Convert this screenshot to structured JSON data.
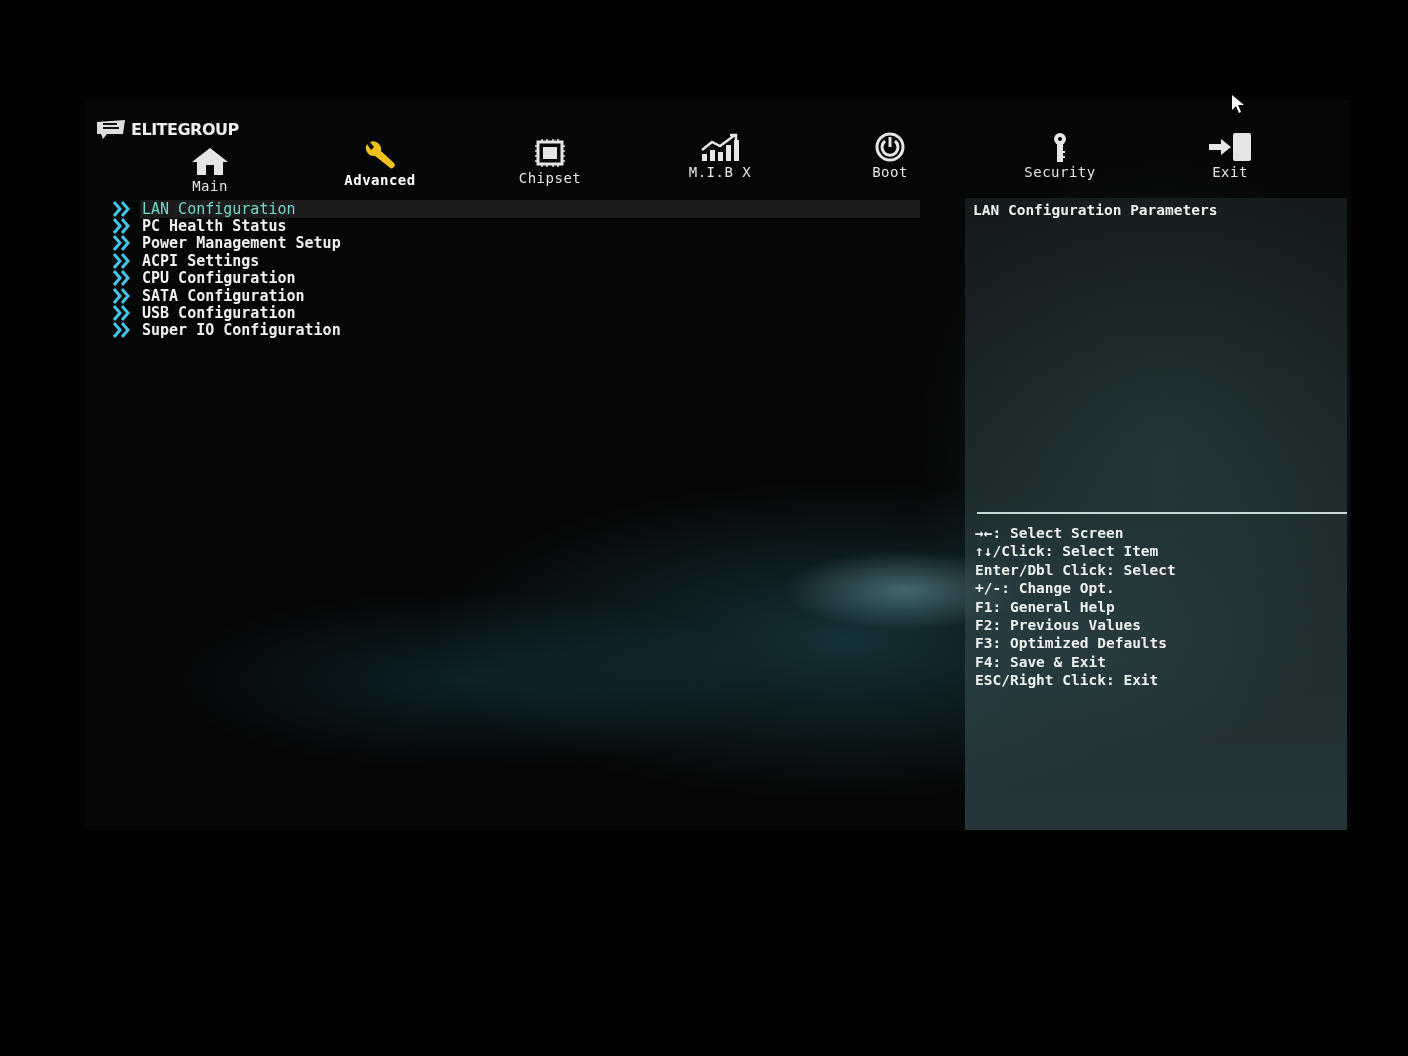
{
  "brand": "ELITEGROUP",
  "tabs": [
    {
      "label": "Main",
      "selected": false
    },
    {
      "label": "Advanced",
      "selected": true
    },
    {
      "label": "Chipset",
      "selected": false
    },
    {
      "label": "M.I.B X",
      "selected": false
    },
    {
      "label": "Boot",
      "selected": false
    },
    {
      "label": "Security",
      "selected": false
    },
    {
      "label": "Exit",
      "selected": false
    }
  ],
  "menu": [
    {
      "label": "LAN Configuration",
      "selected": true
    },
    {
      "label": "PC Health Status",
      "selected": false
    },
    {
      "label": "Power Management Setup",
      "selected": false
    },
    {
      "label": "ACPI Settings",
      "selected": false
    },
    {
      "label": "CPU Configuration",
      "selected": false
    },
    {
      "label": "SATA Configuration",
      "selected": false
    },
    {
      "label": "USB Configuration",
      "selected": false
    },
    {
      "label": "Super IO Configuration",
      "selected": false
    }
  ],
  "help": {
    "title": "LAN Configuration Parameters",
    "keys": [
      "→←: Select Screen",
      "↑↓/Click: Select Item",
      "Enter/Dbl Click: Select",
      "+/-: Change Opt.",
      "F1: General Help",
      "F2: Previous Values",
      "F3: Optimized Defaults",
      "F4: Save & Exit",
      "ESC/Right Click: Exit"
    ]
  }
}
